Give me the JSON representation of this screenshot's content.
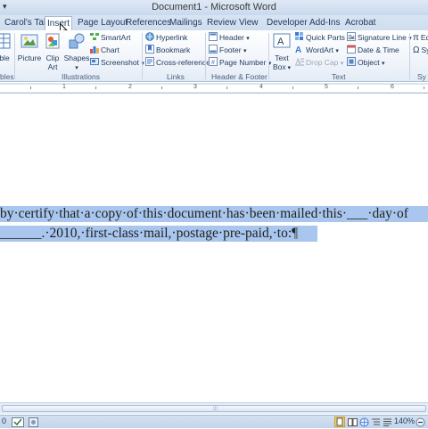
{
  "window": {
    "title": "Document1 - Microsoft Word",
    "qat_arrow": "▾"
  },
  "tabs": [
    {
      "label": "Carol's Tab",
      "active": false
    },
    {
      "label": "Insert",
      "active": true
    },
    {
      "label": "Page Layout",
      "active": false
    },
    {
      "label": "References",
      "active": false
    },
    {
      "label": "Mailings",
      "active": false
    },
    {
      "label": "Review",
      "active": false
    },
    {
      "label": "View",
      "active": false
    },
    {
      "label": "Developer",
      "active": false
    },
    {
      "label": "Add-Ins",
      "active": false
    },
    {
      "label": "Acrobat",
      "active": false
    }
  ],
  "ribbon": {
    "tables": {
      "button": "ble",
      "group": "bles"
    },
    "illustrations": {
      "group": "Illustrations",
      "picture": "Picture",
      "clip_art_1": "Clip",
      "clip_art_2": "Art",
      "shapes": "Shapes",
      "smartart": "SmartArt",
      "chart": "Chart",
      "screenshot": "Screenshot"
    },
    "links": {
      "group": "Links",
      "hyperlink": "Hyperlink",
      "bookmark": "Bookmark",
      "cross_reference": "Cross-reference"
    },
    "header_footer": {
      "group": "Header & Footer",
      "header": "Header",
      "footer": "Footer",
      "page_number": "Page Number"
    },
    "text": {
      "group": "Text",
      "text_box_1": "Text",
      "text_box_2": "Box",
      "quick_parts": "Quick Parts",
      "wordart": "WordArt",
      "drop_cap": "Drop Cap",
      "signature_line": "Signature Line",
      "date_time": "Date & Time",
      "object": "Object"
    },
    "symbols": {
      "group": "Sy",
      "equation": "Eq",
      "symbol": "Sy"
    }
  },
  "ruler": {
    "numbers": [
      "1",
      "2",
      "3",
      "4",
      "5",
      "6"
    ]
  },
  "document": {
    "line1": "by·certify·that·a·copy·of·this·document·has·been·mailed·this·___·day·of",
    "line2": "______.·2010,·first-class·mail,·postage·pre-paid,·to:¶"
  },
  "status": {
    "page": "0",
    "zoom": "140%"
  },
  "colors": {
    "selection": "#a9c6ee",
    "ribbon_accent": "#1e395b"
  }
}
